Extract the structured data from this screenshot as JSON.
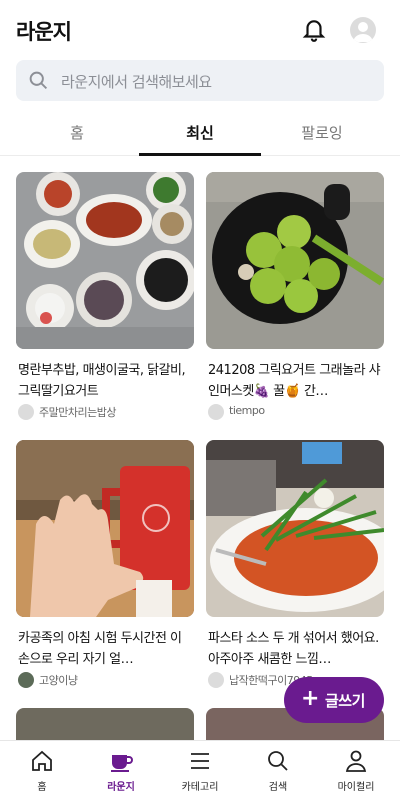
{
  "header": {
    "title": "라운지",
    "bell_icon": "bell-icon",
    "avatar_icon": "profile-avatar-icon"
  },
  "search": {
    "placeholder": "라운지에서 검색해보세요",
    "icon": "search-icon"
  },
  "tabs": [
    {
      "label": "홈",
      "active": false
    },
    {
      "label": "최신",
      "active": true
    },
    {
      "label": "팔로잉",
      "active": false
    }
  ],
  "feed": [
    {
      "title": "명란부추밥, 매생이굴국, 닭갈비, 그릭딸기요거트",
      "author": "주말만차리는밥상",
      "image": "korean-meal-table-photo"
    },
    {
      "title": "241208 그릭요거트 그래놀라 샤인머스켓🍇 꿀🍯 간…",
      "author": "tiempo",
      "image": "shine-muscat-bowl-photo"
    },
    {
      "title": "카공족의 아침  시험 두시간전  이 손으로 우리 자기 얼…",
      "author": "고양이냥",
      "image": "hand-and-red-cup-photo"
    },
    {
      "title": "파스타 소스 두 개 섞어서 했어요. 아주아주 새콤한 느낌…",
      "author": "납작한떡구이7945",
      "image": "pasta-plate-photo"
    }
  ],
  "fab": {
    "label": "글쓰기",
    "icon": "plus-icon"
  },
  "bottom_nav": [
    {
      "label": "홈",
      "icon": "home-icon",
      "active": false
    },
    {
      "label": "라운지",
      "icon": "coffee-cup-icon",
      "active": true
    },
    {
      "label": "카테고리",
      "icon": "menu-icon",
      "active": false
    },
    {
      "label": "검색",
      "icon": "search-icon",
      "active": false
    },
    {
      "label": "마이컬리",
      "icon": "person-icon",
      "active": false
    }
  ],
  "colors": {
    "accent": "#6a1b8f",
    "search_bg": "#eef1f5",
    "text": "#111111",
    "muted": "#777777"
  }
}
